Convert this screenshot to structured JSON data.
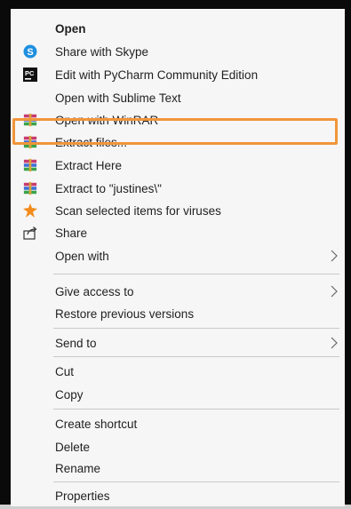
{
  "context_menu": {
    "items": [
      {
        "label": "Open",
        "icon": "none",
        "bold": true
      },
      {
        "label": "Share with Skype",
        "icon": "skype-icon"
      },
      {
        "label": "Edit with PyCharm Community Edition",
        "icon": "pycharm-icon"
      },
      {
        "label": "Open with Sublime Text",
        "icon": "none"
      },
      {
        "label": "Open with WinRAR",
        "icon": "winrar-icon"
      },
      {
        "label": "Extract files...",
        "icon": "winrar-icon",
        "highlighted": true
      },
      {
        "label": "Extract Here",
        "icon": "winrar-icon"
      },
      {
        "label": "Extract to \"justines\\\"",
        "icon": "winrar-icon"
      },
      {
        "label": "Scan selected items for viruses",
        "icon": "avast-icon"
      },
      {
        "label": "Share",
        "icon": "share-icon"
      },
      {
        "label": "Open with",
        "icon": "none",
        "submenu": true
      },
      {
        "label": "Give access to",
        "icon": "none",
        "submenu": true
      },
      {
        "label": "Restore previous versions",
        "icon": "none"
      },
      {
        "label": "Send to",
        "icon": "none",
        "submenu": true
      },
      {
        "label": "Cut",
        "icon": "none"
      },
      {
        "label": "Copy",
        "icon": "none"
      },
      {
        "label": "Create shortcut",
        "icon": "none"
      },
      {
        "label": "Delete",
        "icon": "none"
      },
      {
        "label": "Rename",
        "icon": "none"
      },
      {
        "label": "Properties",
        "icon": "none"
      }
    ]
  },
  "colors": {
    "highlight_border": "#f0953a",
    "skype": "#1e8fe0",
    "pycharm": "#111111",
    "winrar": "#8b2b7a",
    "avast": "#f28c1b"
  }
}
